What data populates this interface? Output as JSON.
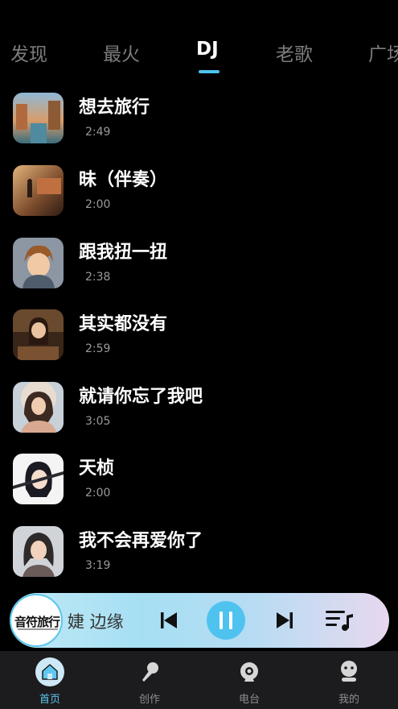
{
  "tabs": [
    {
      "label": "发现",
      "active": false
    },
    {
      "label": "最火",
      "active": false
    },
    {
      "label": "DJ",
      "active": true
    },
    {
      "label": "老歌",
      "active": false
    },
    {
      "label": "广场",
      "active": false
    }
  ],
  "songs": [
    {
      "title": "想去旅行",
      "duration": "2:49"
    },
    {
      "title": "昧（伴奏）",
      "duration": "2:00"
    },
    {
      "title": "跟我扭一扭",
      "duration": "2:38"
    },
    {
      "title": "其实都没有",
      "duration": "2:59"
    },
    {
      "title": "就请你忘了我吧",
      "duration": "3:05"
    },
    {
      "title": "天桢",
      "duration": "2:00"
    },
    {
      "title": "我不会再爱你了",
      "duration": "3:19"
    }
  ],
  "player": {
    "disc_label": "音符旅行",
    "now_playing_scroll": "婕   边缘",
    "state": "playing"
  },
  "bottom_nav": [
    {
      "label": "首页",
      "icon": "home-icon",
      "active": true
    },
    {
      "label": "创作",
      "icon": "microphone-icon",
      "active": false
    },
    {
      "label": "电台",
      "icon": "radio-icon",
      "active": false
    },
    {
      "label": "我的",
      "icon": "profile-icon",
      "active": false
    }
  ],
  "colors": {
    "accent": "#4fc3f0",
    "background": "#000000",
    "nav_background": "#1c1c1e",
    "inactive_tab": "#7c7c7c"
  }
}
